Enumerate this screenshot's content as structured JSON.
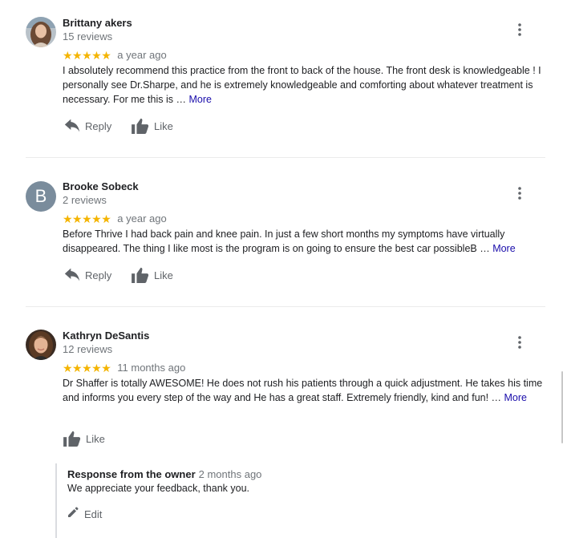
{
  "reviews": [
    {
      "name": "Brittany akers",
      "review_count": "15 reviews",
      "stars": "★★★★★",
      "rating": 5,
      "date": "a year ago",
      "text": "I absolutely recommend this practice from the front to back of the house.  The front desk is knowledgeable ! I personally see Dr.Sharpe, and he is extremely knowledgeable and comforting about whatever treatment is necessary. For me this is … ",
      "more_label": "More",
      "reply_label": "Reply",
      "like_label": "Like",
      "avatar": "photo"
    },
    {
      "name": "Brooke Sobeck",
      "review_count": "2 reviews",
      "stars": "★★★★★",
      "rating": 5,
      "date": "a year ago",
      "text": "Before Thrive I had back pain and knee pain. In just a few short months my symptoms have virtually disappeared. The thing I like most is the program is on going to ensure the best car possibleB … ",
      "more_label": "More",
      "reply_label": "Reply",
      "like_label": "Like",
      "avatar_letter": "B",
      "avatar_color": "#7a8c9c"
    },
    {
      "name": "Kathryn DeSantis",
      "review_count": "12 reviews",
      "stars": "★★★★★",
      "rating": 5,
      "date": "11 months ago",
      "text": "Dr Shaffer is totally AWESOME! He does not rush his patients through a quick adjustment. He takes his time and informs you every step of the way and He has a great staff. Extremely friendly, kind and fun! … ",
      "more_label": "More",
      "like_label": "Like",
      "avatar": "photo",
      "owner_response": {
        "title": "Response from the owner",
        "date": "2 months ago",
        "text": "We appreciate your feedback, thank you.",
        "edit_label": "Edit"
      }
    }
  ],
  "colors": {
    "star": "#f4b400",
    "link": "#1a0dab",
    "secondary_text": "#70757a",
    "icon": "#5f6368"
  },
  "icons": {
    "menu": "more-vert-icon",
    "reply": "reply-icon",
    "like": "thumb-up-icon",
    "edit": "pencil-icon"
  }
}
